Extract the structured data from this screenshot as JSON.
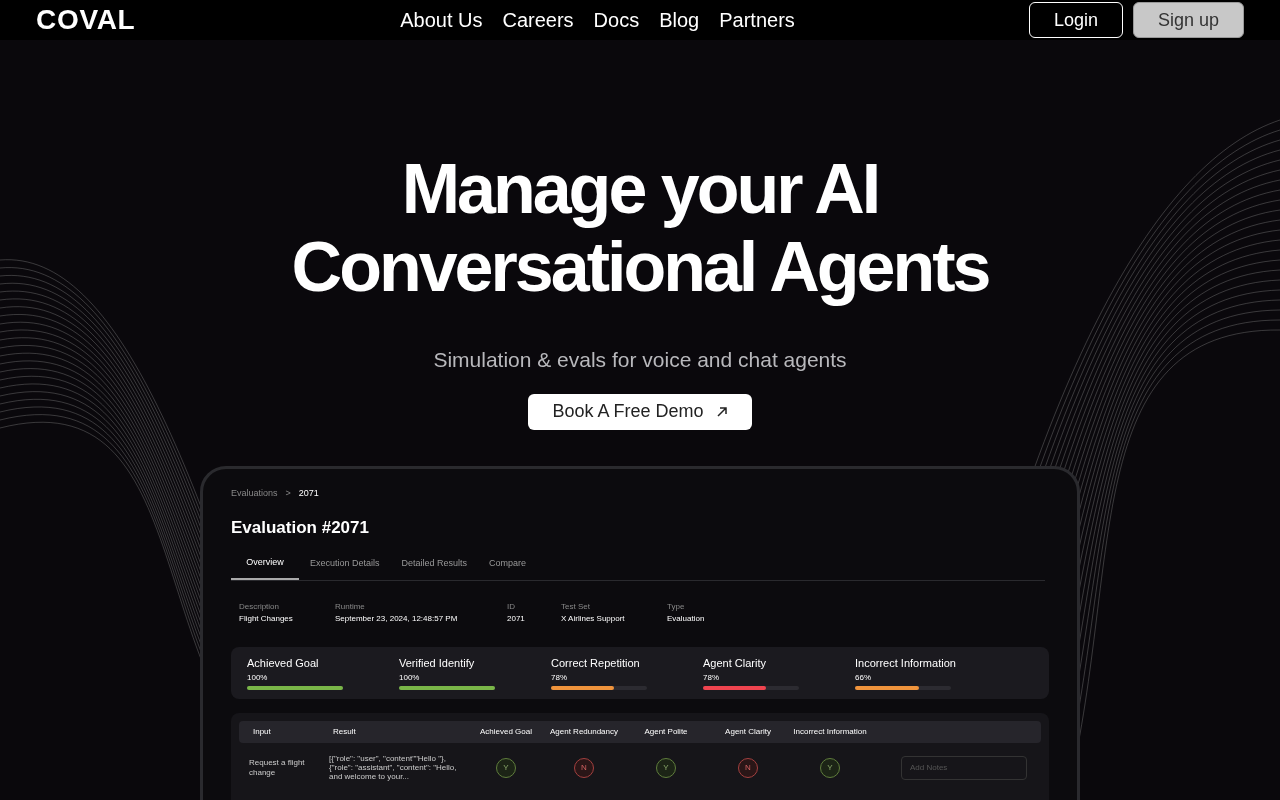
{
  "header": {
    "logo": "COVAL",
    "nav": [
      "About Us",
      "Careers",
      "Docs",
      "Blog",
      "Partners"
    ],
    "login": "Login",
    "signup": "Sign up"
  },
  "hero": {
    "title_lines": [
      "Manage your AI",
      "Conversational Agents"
    ],
    "subtitle": "Simulation & evals for voice and chat agents",
    "cta": "Book A Free Demo"
  },
  "dashboard": {
    "breadcrumb": [
      "Evaluations",
      ">",
      "2071"
    ],
    "title": "Evaluation #2071",
    "tabs": [
      {
        "label": "Overview",
        "selected": true
      },
      {
        "label": "Execution Details",
        "selected": false
      },
      {
        "label": "Detailed Results",
        "selected": false
      },
      {
        "label": "Compare",
        "selected": false
      }
    ],
    "details": [
      {
        "label": "Description",
        "value": "Flight Changes"
      },
      {
        "label": "Runtime",
        "value": "September 23, 2024, 12:48:57 PM"
      },
      {
        "label": "ID",
        "value": "2071"
      },
      {
        "label": "Test Set",
        "value": "X Airlines Support"
      },
      {
        "label": "Type",
        "value": "Evaluation"
      }
    ],
    "metrics": [
      {
        "name": "Achieved Goal",
        "reading": "100%",
        "level": 1,
        "color": "#7ab648"
      },
      {
        "name": "Verified Identify",
        "reading": "100%",
        "level": 1,
        "color": "#7ab648"
      },
      {
        "name": "Correct Repetition",
        "reading": "78%",
        "level": 0.66,
        "color": "#f0943c"
      },
      {
        "name": "Agent Clarity",
        "reading": "78%",
        "level": 0.66,
        "color": "#f0444f"
      },
      {
        "name": "Incorrect Information",
        "reading": "66%",
        "level": 0.67,
        "color": "#f0943c"
      }
    ],
    "table": {
      "columns": [
        "Input",
        "Result",
        "Achieved Goal",
        "Agent Redundancy",
        "Agent Polite",
        "Agent Clarity",
        "Incorrect Information"
      ],
      "rows": [
        {
          "input": "Request a flight change",
          "result": "[{\"role\": \"user\", \"content\"\"Hello \"}, {\"role\": \"assistant\", \"content\": \"Hello, and welcome to your...",
          "marks": [
            {
              "text": "Y",
              "kind": "yes"
            },
            {
              "text": "N",
              "kind": "no"
            },
            {
              "text": "Y",
              "kind": "yes"
            },
            {
              "text": "N",
              "kind": "no"
            },
            {
              "text": "Y",
              "kind": "yes"
            }
          ],
          "notes_placeholder": "Add Notes"
        }
      ]
    }
  }
}
